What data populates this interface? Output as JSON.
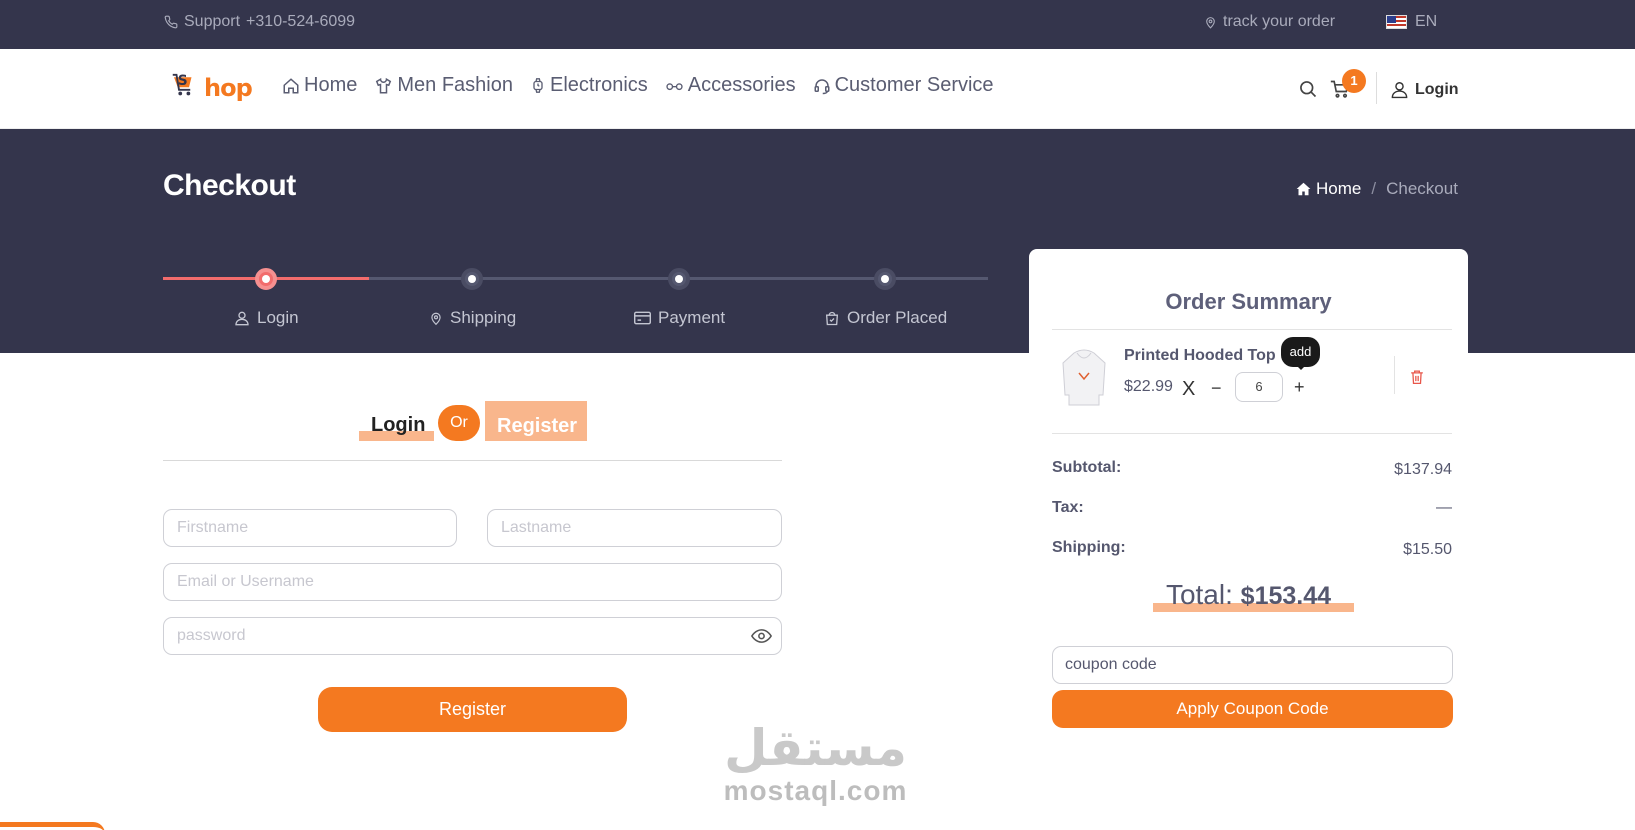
{
  "topbar": {
    "support_label": "Support",
    "support_phone": "+310-524-6099",
    "track_label": "track your order",
    "language": "EN"
  },
  "brand": {
    "logo_letter": "S",
    "logo_text": "hop",
    "accent_color": "#f47920"
  },
  "nav": {
    "items": [
      {
        "label": "Home",
        "icon": "home-icon"
      },
      {
        "label": "Men Fashion",
        "icon": "tshirt-icon"
      },
      {
        "label": "Electronics",
        "icon": "watch-icon"
      },
      {
        "label": "Accessories",
        "icon": "glasses-icon"
      },
      {
        "label": "Customer Service",
        "icon": "headset-icon"
      }
    ],
    "cart_count": "1",
    "login_label": "Login"
  },
  "hero": {
    "title": "Checkout",
    "breadcrumb": {
      "home": "Home",
      "separator": "/",
      "current": "Checkout"
    },
    "background_color": "#34354c"
  },
  "steps": [
    {
      "label": "Login",
      "icon": "user-icon",
      "active": true
    },
    {
      "label": "Shipping",
      "icon": "location-pin-icon",
      "active": false
    },
    {
      "label": "Payment",
      "icon": "credit-card-icon",
      "active": false
    },
    {
      "label": "Order Placed",
      "icon": "bag-check-icon",
      "active": false
    }
  ],
  "auth": {
    "tab_login": "Login",
    "or_label": "Or",
    "tab_register": "Register",
    "fields": {
      "firstname_placeholder": "Firstname",
      "lastname_placeholder": "Lastname",
      "email_placeholder": "Email or Username",
      "password_placeholder": "password"
    },
    "submit_label": "Register"
  },
  "summary": {
    "title": "Order Summary",
    "item": {
      "name": "Printed Hooded Top",
      "price": "$22.99",
      "times": "X",
      "minus": "−",
      "quantity": "6",
      "plus": "+",
      "tooltip": "add"
    },
    "rows": [
      {
        "label": "Subtotal:",
        "value": "$137.94"
      },
      {
        "label": "Tax:",
        "value": "—"
      },
      {
        "label": "Shipping:",
        "value": "$15.50"
      }
    ],
    "total_label": "Total:",
    "total_value": "$153.44",
    "coupon_value": "coupon code",
    "coupon_button": "Apply Coupon Code"
  },
  "watermark": {
    "arabic": "مستقل",
    "latin": "mostaql.com"
  }
}
